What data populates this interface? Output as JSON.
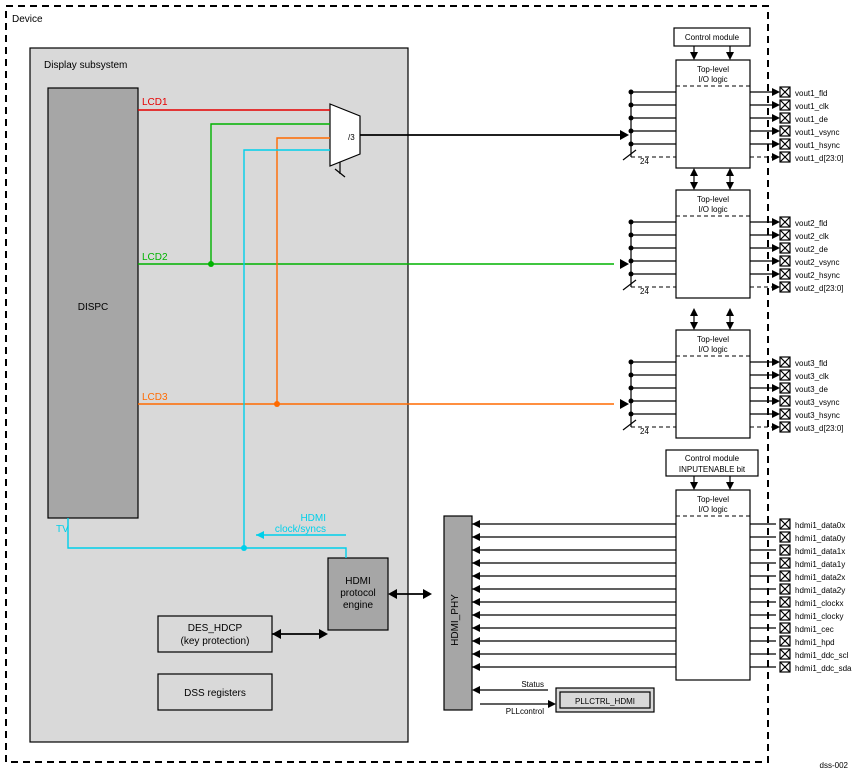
{
  "device_label": "Device",
  "subsystem_label": "Display subsystem",
  "dispc_label": "DISPC",
  "lcd1": "LCD1",
  "lcd2": "LCD2",
  "lcd3": "LCD3",
  "tv": "TV",
  "hdmi_cs": {
    "l1": "HDMI",
    "l2": "clock/syncs"
  },
  "mux_select": "/3",
  "bus_width": "24",
  "ctrl_mod": "Control module",
  "top_io": {
    "l1": "Top-level",
    "l2": "I/O logic"
  },
  "vout1": [
    "vout1_fld",
    "vout1_clk",
    "vout1_de",
    "vout1_vsync",
    "vout1_hsync",
    "vout1_d[23:0]"
  ],
  "vout2": [
    "vout2_fld",
    "vout2_clk",
    "vout2_de",
    "vout2_vsync",
    "vout2_hsync",
    "vout2_d[23:0]"
  ],
  "vout3": [
    "vout3_fld",
    "vout3_clk",
    "vout3_de",
    "vout3_vsync",
    "vout3_hsync",
    "vout3_d[23:0]"
  ],
  "ctrl_mod_inputen": {
    "l1": "Control module",
    "l2": "INPUTENABLE bit"
  },
  "hdmi_sig": [
    "hdmi1_data0x",
    "hdmi1_data0y",
    "hdmi1_data1x",
    "hdmi1_data1y",
    "hdmi1_data2x",
    "hdmi1_data2y",
    "hdmi1_clockx",
    "hdmi1_clocky",
    "hdmi1_cec",
    "hdmi1_hpd",
    "hdmi1_ddc_scl",
    "hdmi1_ddc_sda"
  ],
  "hdmi_proto": {
    "l1": "HDMI",
    "l2": "protocol",
    "l3": "engine"
  },
  "des_hdcp": {
    "l1": "DES_HDCP",
    "l2": "(key protection)"
  },
  "dss_regs": "DSS registers",
  "hdmi_phy": "HDMI_PHY",
  "pll_status": "Status",
  "pll_control": "PLLcontrol",
  "pllctrl": "PLLCTRL_HDMI",
  "fig_id": "dss-002"
}
